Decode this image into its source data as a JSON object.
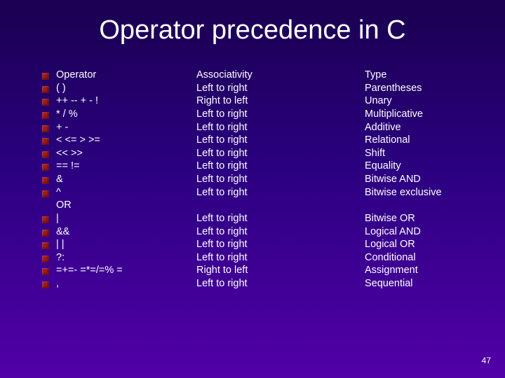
{
  "title": "Operator precedence in C",
  "headers": {
    "op": "Operator",
    "assoc": "Associativity",
    "type": "Type"
  },
  "rows": [
    {
      "op": "( )",
      "assoc": "Left to right",
      "type": "Parentheses",
      "bullet": true
    },
    {
      "op": "++  --   +  -  !",
      "assoc": "Right to left",
      "type": "Unary",
      "bullet": true
    },
    {
      "op": "*  /  %",
      "assoc": "Left to right",
      "type": "Multiplicative",
      "bullet": true
    },
    {
      "op": "+  -",
      "assoc": "Left to right",
      "type": "Additive",
      "bullet": true
    },
    {
      "op": "<  <=  >  >=",
      "assoc": "Left to right",
      "type": "Relational",
      "bullet": true
    },
    {
      "op": "<<  >>",
      "assoc": "Left to right",
      "type": "Shift",
      "bullet": true
    },
    {
      "op": "== !=",
      "assoc": "Left to right",
      "type": "Equality",
      "bullet": true
    },
    {
      "op": "&",
      "assoc": "Left to right",
      "type": "Bitwise AND",
      "bullet": true
    },
    {
      "op": "^",
      "assoc": "Left to right",
      "type": "Bitwise exclusive",
      "bullet": true
    },
    {
      "op": "OR",
      "assoc": "",
      "type": "",
      "bullet": false
    },
    {
      "op": "|",
      "assoc": "Left to right",
      "type": "Bitwise OR",
      "bullet": true
    },
    {
      "op": "&&",
      "assoc": "Left to right",
      "type": "Logical AND",
      "bullet": true
    },
    {
      "op": "| |",
      "assoc": "Left to right",
      "type": "Logical OR",
      "bullet": true
    },
    {
      "op": "?:",
      "assoc": "Left to right",
      "type": "Conditional",
      "bullet": true
    },
    {
      "op": "=+=- =*=/=% =",
      "assoc": "Right to left",
      "type": "Assignment",
      "bullet": true
    },
    {
      "op": ",",
      "assoc": "Left to right",
      "type": "Sequential",
      "bullet": true
    }
  ],
  "page_number": "47"
}
